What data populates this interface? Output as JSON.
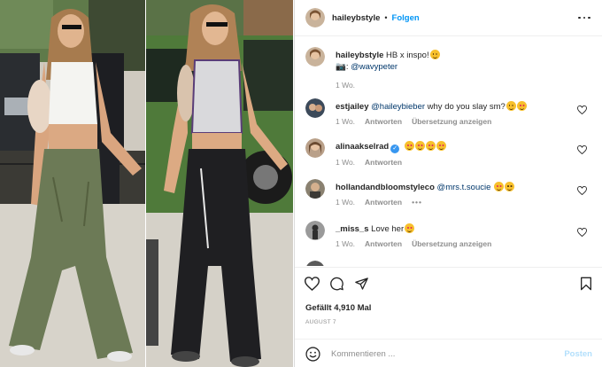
{
  "post": {
    "username": "haileybstyle",
    "follow_label": "Folgen",
    "separator": "•"
  },
  "caption": {
    "username": "haileybstyle",
    "text": "HB x inspo!",
    "credit_prefix": "📷:",
    "credit_mention": "@wavypeter",
    "time": "1 Wo."
  },
  "comments": [
    {
      "username": "estjailey",
      "mention": "@haileybieber",
      "text": "why do you slay sm?",
      "time": "1 Wo.",
      "reply_label": "Antworten",
      "translate_label": "Übersetzung anzeigen"
    },
    {
      "username": "alinaakselrad",
      "mention": "",
      "text": "",
      "time": "1 Wo.",
      "reply_label": "Antworten",
      "translate_label": ""
    },
    {
      "username": "hollandandbloomstyleco",
      "mention": "@mrs.t.soucie",
      "text": "",
      "time": "1 Wo.",
      "reply_label": "Antworten",
      "translate_label": "",
      "more": "•••"
    },
    {
      "username": "_miss_s",
      "mention": "",
      "text": "Love her",
      "time": "1 Wo.",
      "reply_label": "Antworten",
      "translate_label": "Übersetzung anzeigen"
    }
  ],
  "actions": {
    "likes": "Gefällt 4,910 Mal",
    "date": "AUGUST 7"
  },
  "comment_box": {
    "placeholder": "Kommentieren ...",
    "post_label": "Posten"
  },
  "icons": {
    "more": "more-horizontal-icon",
    "like": "heart-icon",
    "comment": "comment-icon",
    "share": "paper-plane-icon",
    "save": "bookmark-icon",
    "emoji": "smiley-icon"
  },
  "colors": {
    "link_blue": "#0095f6",
    "mention_blue": "#00376b",
    "muted": "#8e8e8e",
    "text": "#262626",
    "post_disabled": "#b2dffc",
    "verified": "#3897f0"
  }
}
